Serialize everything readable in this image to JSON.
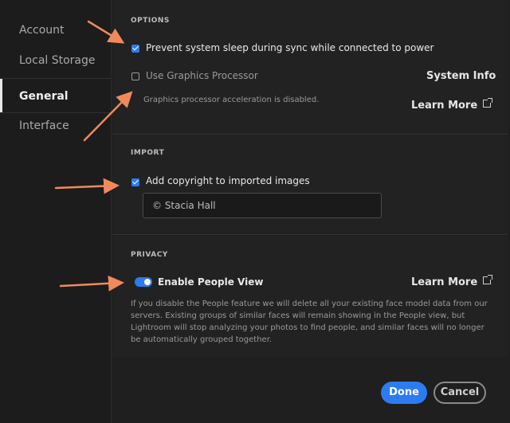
{
  "sidebar": {
    "items": [
      {
        "label": "Account"
      },
      {
        "label": "Local Storage"
      },
      {
        "label": "General"
      },
      {
        "label": "Interface"
      }
    ]
  },
  "options": {
    "title": "OPTIONS",
    "prevent_sleep": {
      "label": "Prevent system sleep during sync while connected to power",
      "checked": true
    },
    "gpu": {
      "label": "Use Graphics Processor",
      "checked": false,
      "note": "Graphics processor acceleration is disabled."
    },
    "system_info": "System Info",
    "learn_more": "Learn More"
  },
  "import": {
    "title": "IMPORT",
    "copyright": {
      "label": "Add copyright to imported images",
      "checked": true
    },
    "copyright_value": "© Stacia Hall"
  },
  "privacy": {
    "title": "PRIVACY",
    "people_view": {
      "label": "Enable People View",
      "enabled": true
    },
    "learn_more": "Learn More",
    "description": "If you disable the People feature we will delete all your existing face model data from our servers. Existing groups of similar faces will remain showing in the People view, but Lightroom will stop analyzing your photos to find people, and similar faces will no longer be automatically grouped together."
  },
  "footer": {
    "done": "Done",
    "cancel": "Cancel"
  },
  "colors": {
    "accent": "#2d7bf0",
    "annotation_arrow": "#f08a5d"
  }
}
